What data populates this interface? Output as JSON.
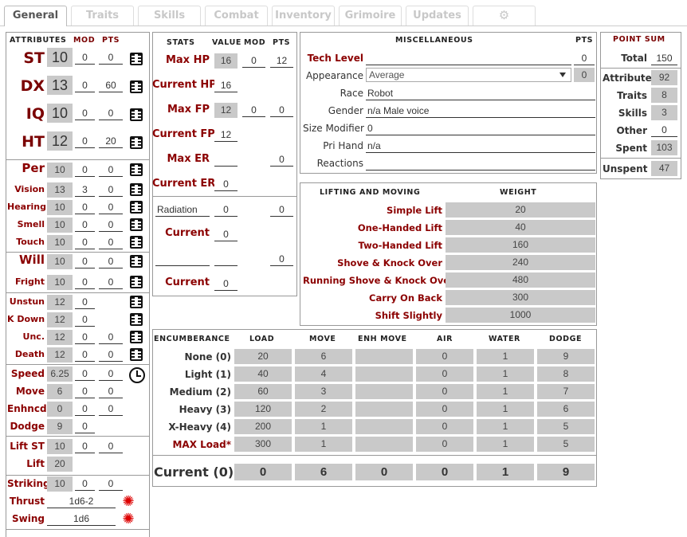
{
  "tabs": [
    "General",
    "Traits",
    "Skills",
    "Combat",
    "Inventory",
    "Grimoire",
    "Updates"
  ],
  "attributes": {
    "hdr": {
      "title": "ATTRIBUTES",
      "mod": "MOD",
      "pts": "PTS"
    },
    "primary": [
      {
        "label": "ST",
        "value": "10",
        "mod": "0",
        "pts": "0"
      },
      {
        "label": "DX",
        "value": "13",
        "mod": "0",
        "pts": "60"
      },
      {
        "label": "IQ",
        "value": "10",
        "mod": "0",
        "pts": "0"
      },
      {
        "label": "HT",
        "value": "12",
        "mod": "0",
        "pts": "20"
      }
    ],
    "senses": [
      {
        "label": "Per",
        "value": "10",
        "mod": "0",
        "pts": "0"
      },
      {
        "label": "Vision",
        "value": "13",
        "mod": "3",
        "pts": "0"
      },
      {
        "label": "Hearing",
        "value": "10",
        "mod": "0",
        "pts": "0"
      },
      {
        "label": "Smell",
        "value": "10",
        "mod": "0",
        "pts": "0"
      },
      {
        "label": "Touch",
        "value": "10",
        "mod": "0",
        "pts": "0"
      }
    ],
    "will": [
      {
        "label": "Will",
        "value": "10",
        "mod": "0",
        "pts": "0"
      },
      {
        "label": "Fright",
        "value": "10",
        "mod": "0",
        "pts": "0"
      }
    ],
    "status": [
      {
        "label": "Unstun",
        "value": "12",
        "mod": "0"
      },
      {
        "label": "K Down",
        "value": "12",
        "mod": "0"
      },
      {
        "label": "Unc.",
        "value": "12",
        "mod": "0",
        "pts": "0"
      },
      {
        "label": "Death",
        "value": "12",
        "mod": "0",
        "pts": "0"
      }
    ],
    "speed": [
      {
        "label": "Speed",
        "value": "6.25",
        "mod": "0",
        "pts": "0"
      },
      {
        "label": "Move",
        "value": "6",
        "mod": "0",
        "pts": "0"
      },
      {
        "label": "Enhncd",
        "value": "0",
        "mod": "0",
        "pts": "0"
      },
      {
        "label": "Dodge",
        "value": "9",
        "mod": "0"
      }
    ],
    "lift": [
      {
        "label": "Lift ST",
        "value": "10",
        "mod": "0",
        "pts": "0"
      },
      {
        "label": "Lift",
        "value": "20"
      }
    ],
    "striking": {
      "label": "Striking",
      "value": "10",
      "mod": "0",
      "pts": "0"
    },
    "thrust": {
      "label": "Thrust",
      "value": "1d6-2"
    },
    "swing": {
      "label": "Swing",
      "value": "1d6"
    }
  },
  "stats": {
    "hdr": {
      "title": "STATS",
      "value": "VALUE",
      "mod": "MOD",
      "pts": "PTS"
    },
    "max_hp": {
      "label": "Max HP",
      "value": "16",
      "mod": "0",
      "pts": "12"
    },
    "cur_hp": {
      "label": "Current HP",
      "value": "16"
    },
    "max_fp": {
      "label": "Max FP",
      "value": "12",
      "mod": "0",
      "pts": "0"
    },
    "cur_fp": {
      "label": "Current FP",
      "value": "12"
    },
    "max_er": {
      "label": "Max ER",
      "value": "",
      "pts": "0"
    },
    "cur_er": {
      "label": "Current ER",
      "value": "0"
    },
    "res1": {
      "name": "Radiation",
      "value": "0",
      "pts": "0",
      "current_label": "Current",
      "current": "0"
    },
    "res2": {
      "name": "",
      "value": "",
      "pts": "0",
      "current_label": "Current",
      "current": "0"
    }
  },
  "misc": {
    "title": "MISCELLANEOUS",
    "pts_hdr": "PTS",
    "tech_level": {
      "label": "Tech Level",
      "value": "",
      "pts": "0"
    },
    "appearance": {
      "label": "Appearance",
      "value": "Average",
      "pts": "0"
    },
    "race": {
      "label": "Race",
      "value": "Robot"
    },
    "gender": {
      "label": "Gender",
      "value": "n/a Male voice"
    },
    "size": {
      "label": "Size Modifier",
      "value": "0"
    },
    "hand": {
      "label": "Pri Hand",
      "value": "n/a"
    },
    "reactions": {
      "label": "Reactions",
      "value": ""
    }
  },
  "points": {
    "title": "POINT SUM",
    "total": {
      "label": "Total",
      "value": "150"
    },
    "rows": [
      {
        "label": "Attributes",
        "value": "92"
      },
      {
        "label": "Traits",
        "value": "8"
      },
      {
        "label": "Skills",
        "value": "3"
      },
      {
        "label": "Other",
        "value": "0"
      },
      {
        "label": "Spent",
        "value": "103"
      }
    ],
    "unspent": {
      "label": "Unspent",
      "value": "47"
    }
  },
  "lifting": {
    "title": "LIFTING AND MOVING",
    "weight_hdr": "WEIGHT",
    "rows": [
      {
        "label": "Simple Lift",
        "value": "20"
      },
      {
        "label": "One-Handed Lift",
        "value": "40"
      },
      {
        "label": "Two-Handed Lift",
        "value": "160"
      },
      {
        "label": "Shove & Knock Over",
        "value": "240"
      },
      {
        "label": "Running Shove & Knock Over",
        "value": "480"
      },
      {
        "label": "Carry On Back",
        "value": "300"
      },
      {
        "label": "Shift Slightly",
        "value": "1000"
      }
    ]
  },
  "encumbrance": {
    "headers": [
      "ENCUMBERANCE",
      "LOAD",
      "MOVE",
      "ENH MOVE",
      "AIR",
      "WATER",
      "DODGE"
    ],
    "rows": [
      {
        "label": "None (0)",
        "load": "20",
        "move": "6",
        "enh": "",
        "air": "0",
        "water": "1",
        "dodge": "9"
      },
      {
        "label": "Light (1)",
        "load": "40",
        "move": "4",
        "enh": "",
        "air": "0",
        "water": "1",
        "dodge": "8"
      },
      {
        "label": "Medium (2)",
        "load": "60",
        "move": "3",
        "enh": "",
        "air": "0",
        "water": "1",
        "dodge": "7"
      },
      {
        "label": "Heavy (3)",
        "load": "120",
        "move": "2",
        "enh": "",
        "air": "0",
        "water": "1",
        "dodge": "6"
      },
      {
        "label": "X-Heavy (4)",
        "load": "200",
        "move": "1",
        "enh": "",
        "air": "0",
        "water": "1",
        "dodge": "5"
      },
      {
        "label": "MAX Load*",
        "load": "300",
        "move": "1",
        "enh": "",
        "air": "0",
        "water": "1",
        "dodge": "5"
      }
    ],
    "current": {
      "label": "Current (0)",
      "load": "0",
      "move": "6",
      "enh": "0",
      "air": "0",
      "water": "1",
      "dodge": "9"
    }
  }
}
